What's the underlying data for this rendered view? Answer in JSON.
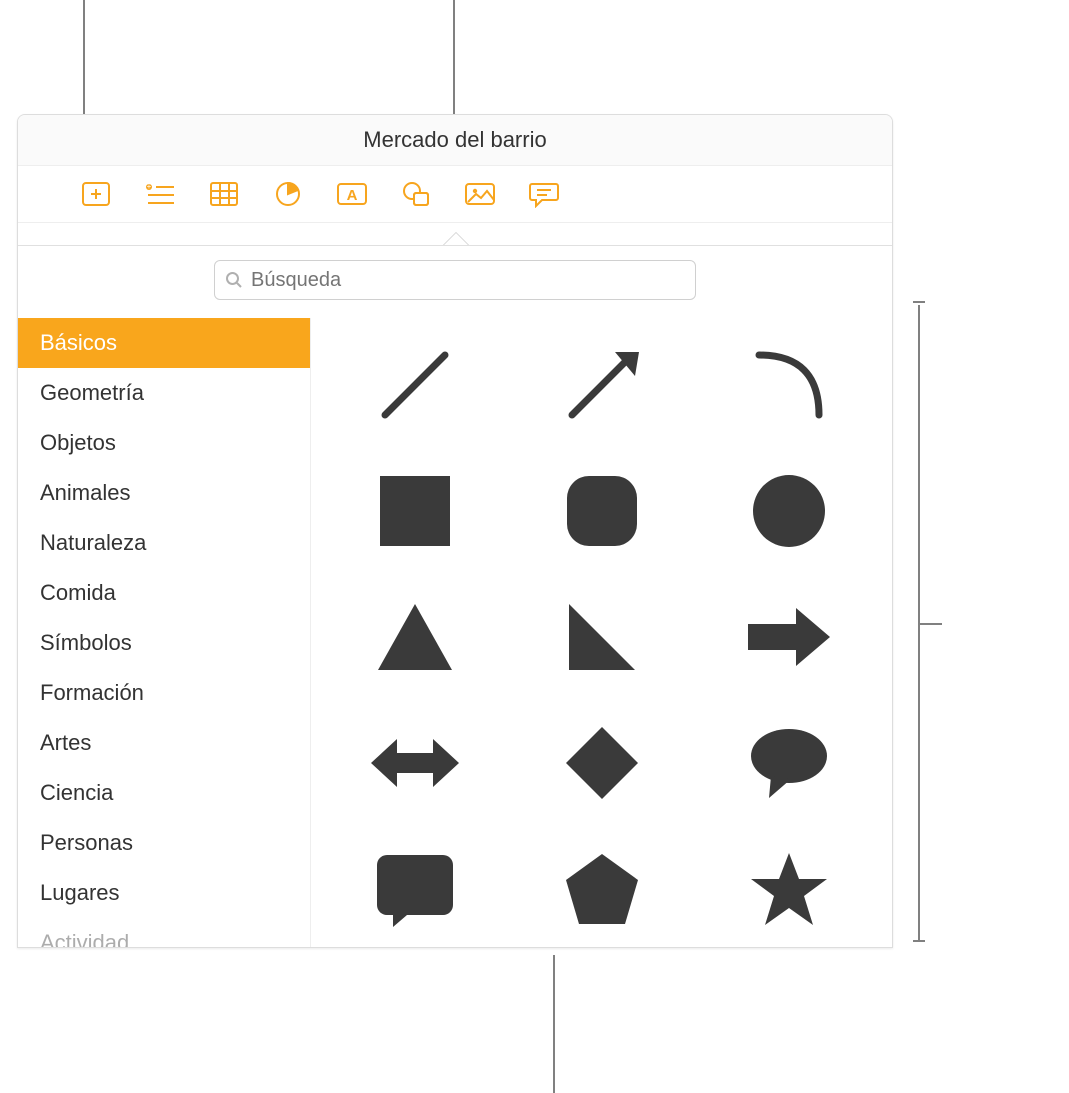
{
  "window": {
    "title": "Mercado del barrio"
  },
  "toolbar": {
    "items": [
      {
        "name": "add-slide-button",
        "icon": "plus-rect"
      },
      {
        "name": "insert-list-button",
        "icon": "list-plus"
      },
      {
        "name": "insert-table-button",
        "icon": "table"
      },
      {
        "name": "insert-chart-button",
        "icon": "pie"
      },
      {
        "name": "insert-text-button",
        "icon": "textbox"
      },
      {
        "name": "insert-shape-button",
        "icon": "shape"
      },
      {
        "name": "insert-image-button",
        "icon": "image"
      },
      {
        "name": "insert-comment-button",
        "icon": "comment"
      }
    ]
  },
  "search": {
    "placeholder": "Búsqueda"
  },
  "categories": [
    {
      "label": "Básicos",
      "selected": true
    },
    {
      "label": "Geometría",
      "selected": false
    },
    {
      "label": "Objetos",
      "selected": false
    },
    {
      "label": "Animales",
      "selected": false
    },
    {
      "label": "Naturaleza",
      "selected": false
    },
    {
      "label": "Comida",
      "selected": false
    },
    {
      "label": "Símbolos",
      "selected": false
    },
    {
      "label": "Formación",
      "selected": false
    },
    {
      "label": "Artes",
      "selected": false
    },
    {
      "label": "Ciencia",
      "selected": false
    },
    {
      "label": "Personas",
      "selected": false
    },
    {
      "label": "Lugares",
      "selected": false
    },
    {
      "label": "Actividad",
      "selected": false
    }
  ],
  "shapes": [
    {
      "name": "line-shape",
      "svg": "line"
    },
    {
      "name": "arrow-line-shape",
      "svg": "arrow-line"
    },
    {
      "name": "curve-shape",
      "svg": "curve"
    },
    {
      "name": "square-shape",
      "svg": "square"
    },
    {
      "name": "rounded-square-shape",
      "svg": "rounded-square"
    },
    {
      "name": "circle-shape",
      "svg": "circle"
    },
    {
      "name": "triangle-shape",
      "svg": "triangle"
    },
    {
      "name": "right-triangle-shape",
      "svg": "right-triangle"
    },
    {
      "name": "arrow-right-shape",
      "svg": "arrow-right"
    },
    {
      "name": "double-arrow-shape",
      "svg": "double-arrow"
    },
    {
      "name": "diamond-shape",
      "svg": "diamond"
    },
    {
      "name": "speech-bubble-shape",
      "svg": "speech-oval"
    },
    {
      "name": "callout-square-shape",
      "svg": "callout-square"
    },
    {
      "name": "pentagon-shape",
      "svg": "pentagon"
    },
    {
      "name": "star-shape",
      "svg": "star"
    }
  ],
  "colors": {
    "accent": "#F9A61C",
    "shape": "#3a3a3a"
  }
}
